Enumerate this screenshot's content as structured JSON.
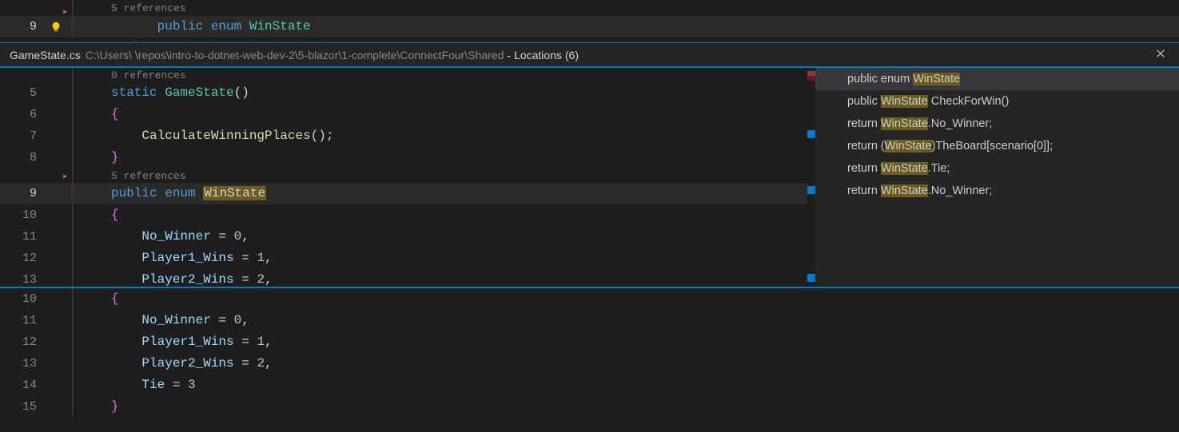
{
  "top_editor": {
    "refs_label": "5 references",
    "line_number": "9",
    "tokens": {
      "public": "public",
      "enum": "enum",
      "WinState": "WinState"
    }
  },
  "peek": {
    "filename": "GameState.cs",
    "path": "C:\\Users\\            \\repos\\intro-to-dotnet-web-dev-2\\5-blazor\\1-complete\\ConnectFour\\Shared",
    "locations_label": "Locations (6)",
    "code": {
      "refs0": "0 references",
      "refs5": "5 references",
      "line5_static": "static",
      "line5_type": "GameState",
      "line5_parens": "()",
      "line6_brace": "{",
      "line7_method": "CalculateWinningPlaces",
      "line7_rest": "();",
      "line8_brace": "}",
      "line9_public": "public",
      "line9_enum": "enum",
      "line9_WinState": "WinState",
      "line10_brace": "{",
      "line11_name": "No_Winner",
      "line11_eq": " = ",
      "line11_val": "0",
      "line12_name": "Player1_Wins",
      "line12_val": "1",
      "line13_name": "Player2_Wins",
      "line13_val": "2",
      "line_numbers": {
        "l5": "5",
        "l6": "6",
        "l7": "7",
        "l8": "8",
        "l9": "9",
        "l10": "10",
        "l11": "11",
        "l12": "12",
        "l13": "13"
      }
    },
    "references": [
      {
        "pre": "public enum ",
        "hl": "WinState",
        "post": ""
      },
      {
        "pre": "public ",
        "hl": "WinState",
        "post": " CheckForWin()"
      },
      {
        "pre": "return ",
        "hl": "WinState",
        "post": ".No_Winner;"
      },
      {
        "pre": "return (",
        "hl": "WinState",
        "post": ")TheBoard[scenario[0]];"
      },
      {
        "pre": "return ",
        "hl": "WinState",
        "post": ".Tie;"
      },
      {
        "pre": "return ",
        "hl": "WinState",
        "post": ".No_Winner;"
      }
    ]
  },
  "bottom_editor": {
    "lines": [
      {
        "n": "10",
        "brace": "{"
      },
      {
        "n": "11",
        "name": "No_Winner",
        "val": "0"
      },
      {
        "n": "12",
        "name": "Player1_Wins",
        "val": "1"
      },
      {
        "n": "13",
        "name": "Player2_Wins",
        "val": "2"
      },
      {
        "n": "14",
        "name": "Tie",
        "val": "3",
        "last": true
      },
      {
        "n": "15",
        "brace": "}"
      }
    ]
  }
}
